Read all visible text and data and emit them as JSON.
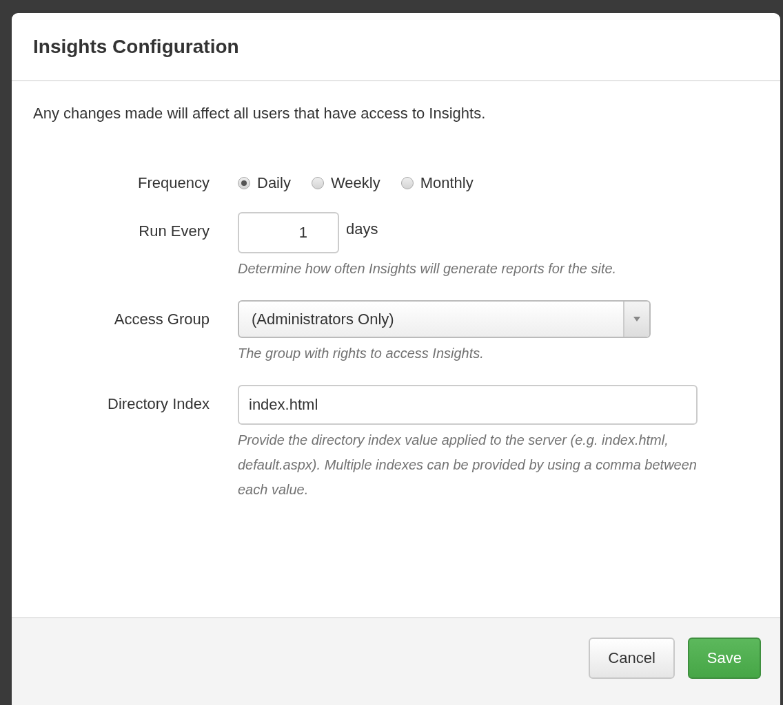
{
  "dialog": {
    "title": "Insights Configuration",
    "notice": "Any changes made will affect all users that have access to Insights.",
    "frequency": {
      "label": "Frequency",
      "options": [
        {
          "label": "Daily",
          "selected": true
        },
        {
          "label": "Weekly",
          "selected": false
        },
        {
          "label": "Monthly",
          "selected": false
        }
      ]
    },
    "run_every": {
      "label": "Run Every",
      "value": "1",
      "unit": "days",
      "help": "Determine how often Insights will generate reports for the site."
    },
    "access_group": {
      "label": "Access Group",
      "value": "(Administrators Only)",
      "help": "The group with rights to access Insights."
    },
    "directory_index": {
      "label": "Directory Index",
      "value": "index.html",
      "help": "Provide the directory index value applied to the server (e.g. index.html, default.aspx). Multiple indexes can be provided by using a comma between each value."
    },
    "buttons": [
      {
        "label": "Cancel",
        "kind": "default"
      },
      {
        "label": "Save",
        "kind": "primary"
      }
    ]
  }
}
